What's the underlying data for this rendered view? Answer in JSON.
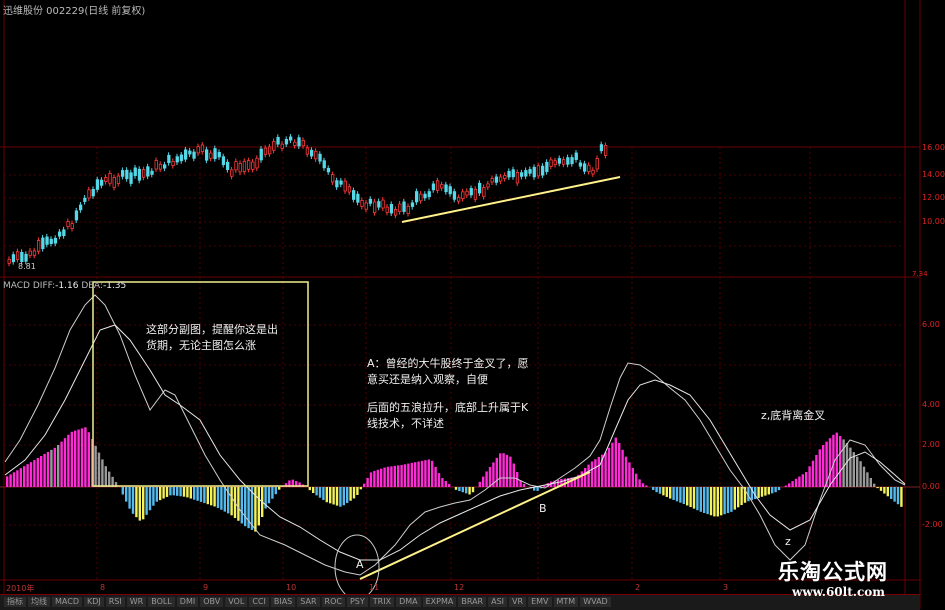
{
  "header": {
    "title": "迅维股份 002229(日线 前复权)"
  },
  "price_axis": {
    "ticks": [
      "16.00",
      "14.00",
      "12.00",
      "10.00"
    ],
    "low_label": "8.81",
    "top_marker": "7.34"
  },
  "indicator": {
    "name": "MACD",
    "diff_label": "DIFF:",
    "diff_value": "-1.16",
    "dea_label": "DEA:",
    "dea_value": "-1.35",
    "ticks": [
      "6.00",
      "4.00",
      "2.00",
      "0.00",
      "-2.00"
    ]
  },
  "annotations": {
    "box_note_line1": "这部分副图，提醒你这是出",
    "box_note_line2": "货期，无论主图怎么涨",
    "a_note_line1": "A：曾经的大牛股终于金叉了，愿",
    "a_note_line2": "意买还是纳入观察，自便",
    "a_note_line3": "后面的五浪拉升，底部上升属于K",
    "a_note_line4": "线技术，不详述",
    "z_note": "z,底背离金叉",
    "point_a": "A",
    "point_b": "B",
    "point_z": "z"
  },
  "date_axis": {
    "labels": [
      "2010年",
      "8",
      "9",
      "10",
      "11",
      "12",
      "2",
      "3"
    ]
  },
  "bottom_tabs": [
    "指标",
    "均线",
    "MACD",
    "KDJ",
    "RSI",
    "WR",
    "BOLL",
    "DMI",
    "OBV",
    "VOL",
    "CCI",
    "BIAS",
    "SAR",
    "ROC",
    "PSY",
    "TRIX",
    "DMA",
    "EXPMA",
    "BRAR",
    "ASI",
    "VR",
    "EMV",
    "MTM",
    "WVAD",
    "CR",
    "更多"
  ],
  "watermark": {
    "title": "乐淘公式网",
    "url": "www.60lt.com"
  },
  "colors": {
    "up_candle": "#ff3a3a",
    "down_candle": "#55d8e8",
    "positive_hist": "#ff2bd6",
    "negative_hist_blue": "#55bbee",
    "negative_hist_yellow": "#f4f35a",
    "trendline": "#fff28a",
    "grid": "#6a0000"
  }
}
